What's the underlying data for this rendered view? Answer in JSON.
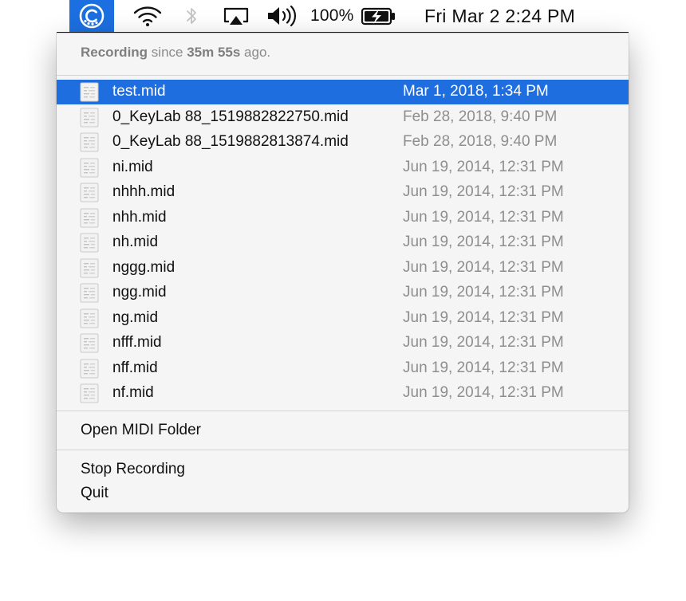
{
  "menubar": {
    "battery_percent": "100%",
    "clock": "Fri Mar 2  2:24 PM",
    "icons": {
      "app": "recorder-c-icon",
      "wifi": "wifi-icon",
      "bluetooth": "bluetooth-icon",
      "airplay": "airplay-icon",
      "volume": "volume-icon",
      "battery": "battery-charging-icon"
    }
  },
  "menu": {
    "status": {
      "prefix": "Recording",
      "since": " since ",
      "duration": "35m 55s",
      "suffix": " ago."
    },
    "files": [
      {
        "name": "test.mid",
        "date": "Mar 1, 2018, 1:34 PM",
        "selected": true
      },
      {
        "name": "0_KeyLab 88_1519882822750.mid",
        "date": "Feb 28, 2018, 9:40 PM"
      },
      {
        "name": "0_KeyLab 88_1519882813874.mid",
        "date": "Feb 28, 2018, 9:40 PM"
      },
      {
        "name": "ni.mid",
        "date": "Jun 19, 2014, 12:31 PM"
      },
      {
        "name": "nhhh.mid",
        "date": "Jun 19, 2014, 12:31 PM"
      },
      {
        "name": "nhh.mid",
        "date": "Jun 19, 2014, 12:31 PM"
      },
      {
        "name": "nh.mid",
        "date": "Jun 19, 2014, 12:31 PM"
      },
      {
        "name": "nggg.mid",
        "date": "Jun 19, 2014, 12:31 PM"
      },
      {
        "name": "ngg.mid",
        "date": "Jun 19, 2014, 12:31 PM"
      },
      {
        "name": "ng.mid",
        "date": "Jun 19, 2014, 12:31 PM"
      },
      {
        "name": "nfff.mid",
        "date": "Jun 19, 2014, 12:31 PM"
      },
      {
        "name": "nff.mid",
        "date": "Jun 19, 2014, 12:31 PM"
      },
      {
        "name": "nf.mid",
        "date": "Jun 19, 2014, 12:31 PM"
      }
    ],
    "open_folder": "Open MIDI Folder",
    "stop_recording": "Stop Recording",
    "quit": "Quit"
  },
  "colors": {
    "accent": "#1f6ee0",
    "menu_background": "#f5f5f5",
    "date_text": "#8e8e8e"
  }
}
